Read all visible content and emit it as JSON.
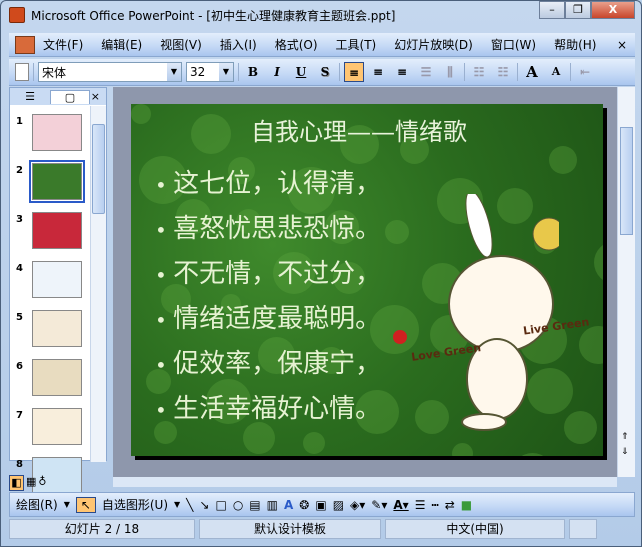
{
  "window": {
    "title": "Microsoft Office PowerPoint - [初中生心理健康教育主题班会.ppt]",
    "minimize": "–",
    "restore": "❐",
    "close": "X"
  },
  "menu": {
    "items": [
      "文件(F)",
      "编辑(E)",
      "视图(V)",
      "插入(I)",
      "格式(O)",
      "工具(T)",
      "幻灯片放映(D)",
      "窗口(W)",
      "帮助(H)"
    ],
    "close": "×"
  },
  "toolbar": {
    "font": "宋体",
    "size": "32",
    "bold": "B",
    "italic": "I",
    "underline": "U",
    "shadow": "S",
    "align_left": "≡",
    "align_center": "≡",
    "align_right": "≡",
    "grow": "A",
    "shrink": "A"
  },
  "left_panel": {
    "tab_outline": "☰",
    "tab_slides": "▢",
    "close": "×",
    "slides": [
      "1",
      "2",
      "3",
      "4",
      "5",
      "6",
      "7",
      "8"
    ],
    "selected": "2"
  },
  "slide": {
    "title": "自我心理——情绪歌",
    "bullets": [
      "这七位，认得清，",
      "喜怒忧思悲恐惊。",
      "不无情，不过分，",
      "情绪适度最聪明。",
      "促效率，保康宁，",
      "生活幸福好心情。"
    ],
    "label_love": "Love Green",
    "label_live": "Live Green"
  },
  "drawing": {
    "draw": "绘图(R)",
    "autoshapes": "自选图形(U)"
  },
  "status": {
    "slide": "幻灯片 2 / 18",
    "template": "默认设计模板",
    "language": "中文(中国)"
  }
}
